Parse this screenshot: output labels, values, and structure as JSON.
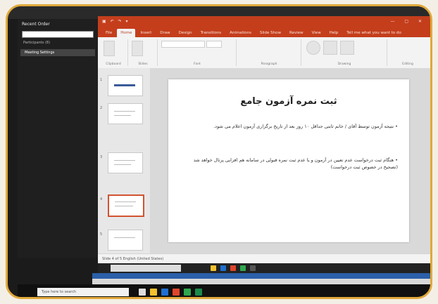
{
  "sidebar": {
    "title": "Recent Order",
    "line1": "Participants (8)",
    "item_selected": "Meeting Settings"
  },
  "ppt": {
    "tabs": [
      "File",
      "Home",
      "Insert",
      "Draw",
      "Design",
      "Transitions",
      "Animations",
      "Slide Show",
      "Review",
      "View",
      "Help",
      "Tell me what you want to do"
    ],
    "active_tab_index": 1,
    "groups": [
      "Clipboard",
      "Slides",
      "Font",
      "Paragraph",
      "Drawing",
      "Editing"
    ]
  },
  "slide": {
    "title": "ثبت نمره آزمون جامع",
    "bullet1": "• نتیجه آزمون توسط آقای / خانم ثابتی حداقل ۱۰ روز بعد از تاریخ برگزاری آزمون اعلام می شود.",
    "bullet2": "• هنگام ثبت درخواست عدم تعیین در آزمون و یا عدم ثبت نمره قبولی در سامانه هم افزایی پرتال خواهد شد (تصحیح در خصوص ثبت درخواست)"
  },
  "status": {
    "text": "Slide 4 of 5   English (United States)"
  },
  "taskbar": {
    "search_placeholder": "Type here to search"
  }
}
